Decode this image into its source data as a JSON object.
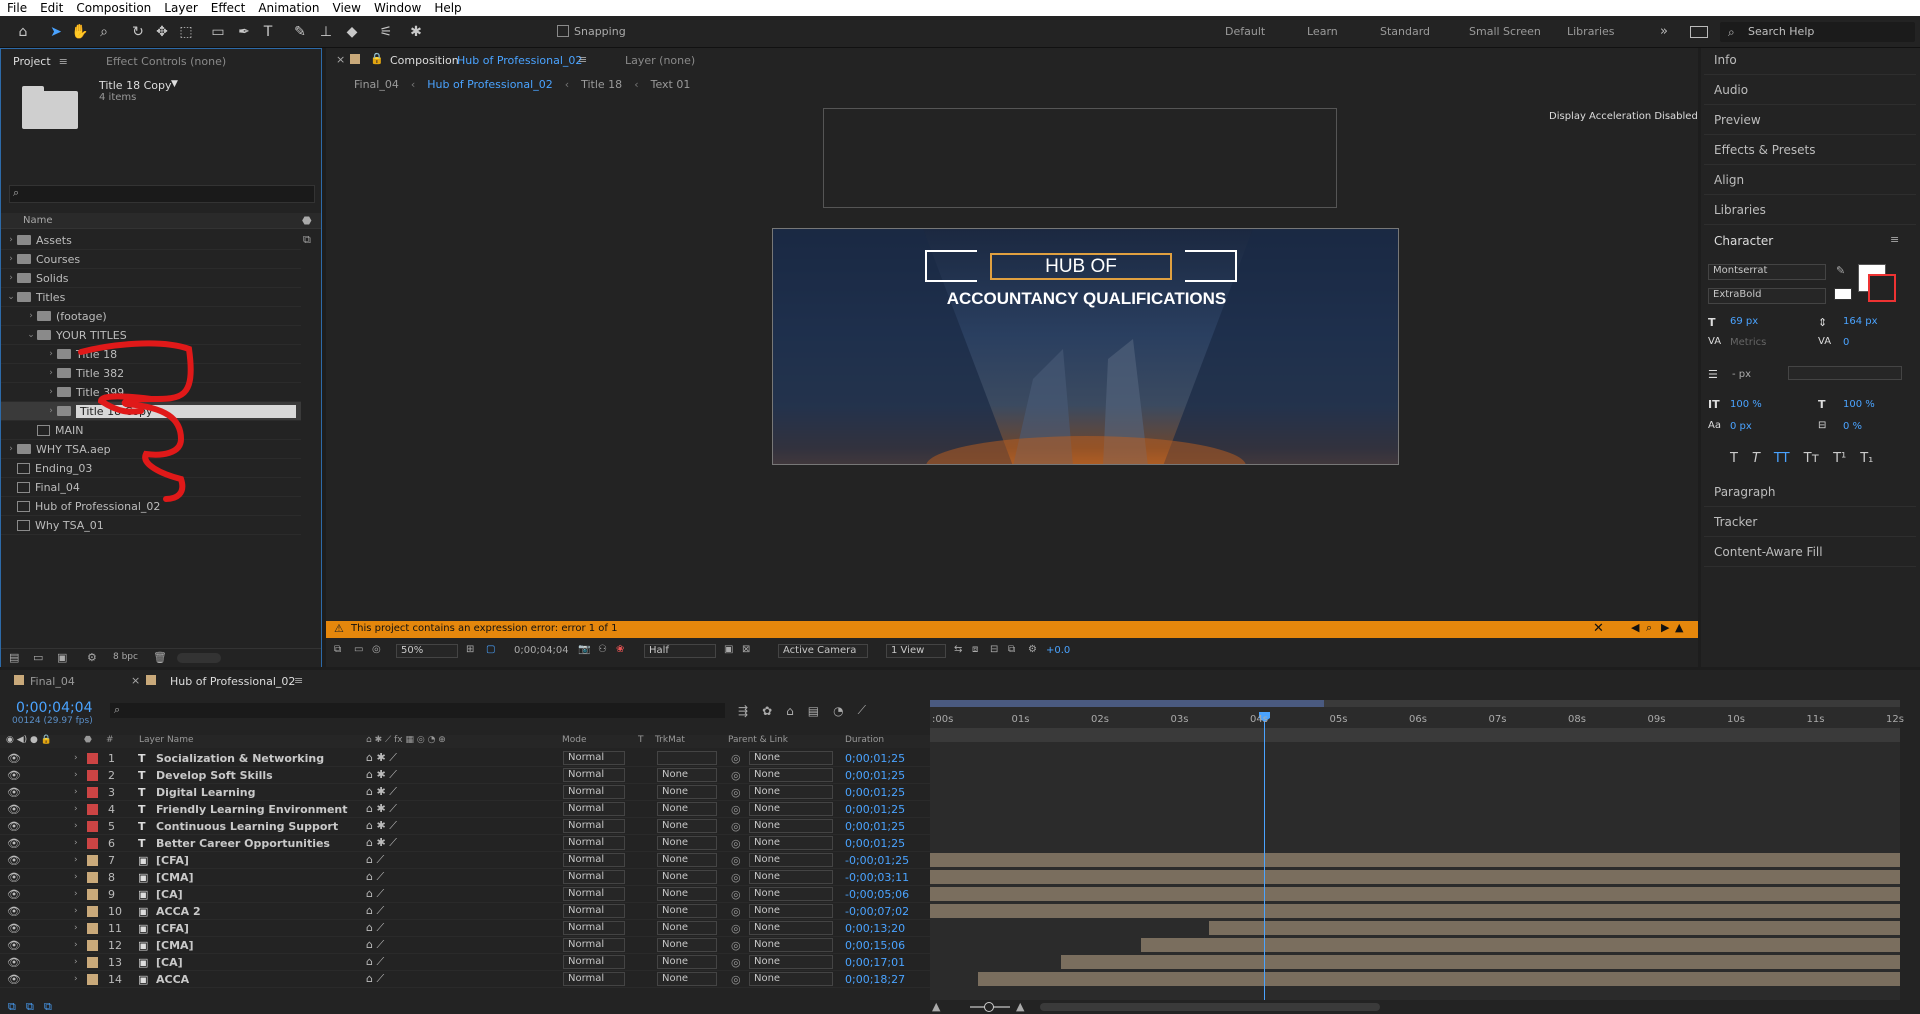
{
  "menu": [
    "File",
    "Edit",
    "Composition",
    "Layer",
    "Effect",
    "Animation",
    "View",
    "Window",
    "Help"
  ],
  "toolbar": {
    "snapping_label": "Snapping",
    "workspaces": [
      "Default",
      "Learn",
      "Standard",
      "Small Screen",
      "Libraries"
    ],
    "search_placeholder": "Search Help"
  },
  "project": {
    "tab_label": "Project",
    "effect_controls": "Effect Controls (none)",
    "selected_name": "Title 18 Copy",
    "selected_info": "4 items",
    "column_name": "Name",
    "bpc": "8 bpc",
    "tree": [
      {
        "name": "Assets",
        "type": "folder",
        "indent": 0
      },
      {
        "name": "Courses",
        "type": "folder",
        "indent": 0
      },
      {
        "name": "Solids",
        "type": "folder",
        "indent": 0
      },
      {
        "name": "Titles",
        "type": "folder",
        "indent": 0,
        "open": true
      },
      {
        "name": "(footage)",
        "type": "folder",
        "indent": 1
      },
      {
        "name": "YOUR TITLES",
        "type": "folder",
        "indent": 1,
        "open": true
      },
      {
        "name": "Title 18",
        "type": "folder",
        "indent": 2
      },
      {
        "name": "Title 382",
        "type": "folder",
        "indent": 2
      },
      {
        "name": "Title 399",
        "type": "folder",
        "indent": 2
      },
      {
        "name": "Title 18 Copy",
        "type": "folder",
        "indent": 2,
        "selected": true
      },
      {
        "name": "MAIN",
        "type": "comp",
        "indent": 1
      },
      {
        "name": "WHY TSA.aep",
        "type": "folder",
        "indent": 0
      },
      {
        "name": "Ending_03",
        "type": "comp",
        "indent": 0
      },
      {
        "name": "Final_04",
        "type": "comp",
        "indent": 0
      },
      {
        "name": "Hub of Professional_02",
        "type": "comp",
        "indent": 0
      },
      {
        "name": "Why TSA_01",
        "type": "comp",
        "indent": 0
      }
    ]
  },
  "composition": {
    "tab_prefix": "Composition",
    "tab_name": "Hub of Professional_02",
    "layer_tab": "Layer (none)",
    "breadcrumbs": [
      "Final_04",
      "Hub of Professional_02",
      "Title 18",
      "Text 01"
    ],
    "display_accel": "Display Acceleration Disabled",
    "title_line1": "HUB OF",
    "title_line2": "ACCOUNTANCY QUALIFICATIONS",
    "error_text": "This project contains an expression error: error 1 of 1",
    "zoom": "50%",
    "timecode": "0;00;04;04",
    "resolution": "Half",
    "camera": "Active Camera",
    "view": "1 View",
    "exposure": "+0.0"
  },
  "right_panels": {
    "items_top": [
      "Info",
      "Audio",
      "Preview",
      "Effects & Presets",
      "Align",
      "Libraries"
    ],
    "character_label": "Character",
    "font_family": "Montserrat",
    "font_style": "ExtraBold",
    "font_size": "69 px",
    "leading": "164 px",
    "kerning": "Metrics",
    "tracking": "0",
    "stroke_width": "- px",
    "vert_scale": "100 %",
    "horiz_scale": "100 %",
    "baseline_shift": "0 px",
    "tsume": "0 %",
    "items_bottom": [
      "Paragraph",
      "Tracker",
      "Content-Aware Fill"
    ]
  },
  "timeline": {
    "tabs": [
      "Final_04",
      "Hub of Professional_02"
    ],
    "timecode": "0;00;04;04",
    "frame_info": "00124 (29.97 fps)",
    "columns": {
      "layer_name": "Layer Name",
      "mode": "Mode",
      "t": "T",
      "trkmat": "TrkMat",
      "parent": "Parent & Link",
      "duration": "Duration"
    },
    "ruler": [
      ":00s",
      "01s",
      "02s",
      "03s",
      "04s",
      "05s",
      "06s",
      "07s",
      "08s",
      "09s",
      "10s",
      "11s",
      "12s"
    ],
    "layers": [
      {
        "num": "1",
        "type": "T",
        "name": "Socialization & Networking",
        "mode": "Normal",
        "trkmat": "",
        "parent": "None",
        "duration": "0;00;01;25",
        "color": "#c44"
      },
      {
        "num": "2",
        "type": "T",
        "name": "Develop Soft Skills",
        "mode": "Normal",
        "trkmat": "None",
        "parent": "None",
        "duration": "0;00;01;25",
        "color": "#c44"
      },
      {
        "num": "3",
        "type": "T",
        "name": "Digital Learning",
        "mode": "Normal",
        "trkmat": "None",
        "parent": "None",
        "duration": "0;00;01;25",
        "color": "#c44"
      },
      {
        "num": "4",
        "type": "T",
        "name": "Friendly Learning Environment",
        "mode": "Normal",
        "trkmat": "None",
        "parent": "None",
        "duration": "0;00;01;25",
        "color": "#c44"
      },
      {
        "num": "5",
        "type": "T",
        "name": "Continuous Learning Support",
        "mode": "Normal",
        "trkmat": "None",
        "parent": "None",
        "duration": "0;00;01;25",
        "color": "#c44"
      },
      {
        "num": "6",
        "type": "T",
        "name": "Better Career Opportunities",
        "mode": "Normal",
        "trkmat": "None",
        "parent": "None",
        "duration": "0;00;01;25",
        "color": "#c44"
      },
      {
        "num": "7",
        "type": "C",
        "name": "[CFA]",
        "mode": "Normal",
        "trkmat": "None",
        "parent": "None",
        "duration": "-0;00;01;25",
        "color": "#c9a97a"
      },
      {
        "num": "8",
        "type": "C",
        "name": "[CMA]",
        "mode": "Normal",
        "trkmat": "None",
        "parent": "None",
        "duration": "-0;00;03;11",
        "color": "#c9a97a"
      },
      {
        "num": "9",
        "type": "C",
        "name": "[CA]",
        "mode": "Normal",
        "trkmat": "None",
        "parent": "None",
        "duration": "-0;00;05;06",
        "color": "#c9a97a"
      },
      {
        "num": "10",
        "type": "C",
        "name": "ACCA 2",
        "mode": "Normal",
        "trkmat": "None",
        "parent": "None",
        "duration": "-0;00;07;02",
        "color": "#c9a97a"
      },
      {
        "num": "11",
        "type": "C",
        "name": "[CFA]",
        "mode": "Normal",
        "trkmat": "None",
        "parent": "None",
        "duration": "0;00;13;20",
        "color": "#c9a97a"
      },
      {
        "num": "12",
        "type": "C",
        "name": "[CMA]",
        "mode": "Normal",
        "trkmat": "None",
        "parent": "None",
        "duration": "0;00;15;06",
        "color": "#c9a97a"
      },
      {
        "num": "13",
        "type": "C",
        "name": "[CA]",
        "mode": "Normal",
        "trkmat": "None",
        "parent": "None",
        "duration": "0;00;17;01",
        "color": "#c9a97a"
      },
      {
        "num": "14",
        "type": "C",
        "name": "ACCA",
        "mode": "Normal",
        "trkmat": "None",
        "parent": "None",
        "duration": "0;00;18;27",
        "color": "#c9a97a"
      }
    ]
  }
}
